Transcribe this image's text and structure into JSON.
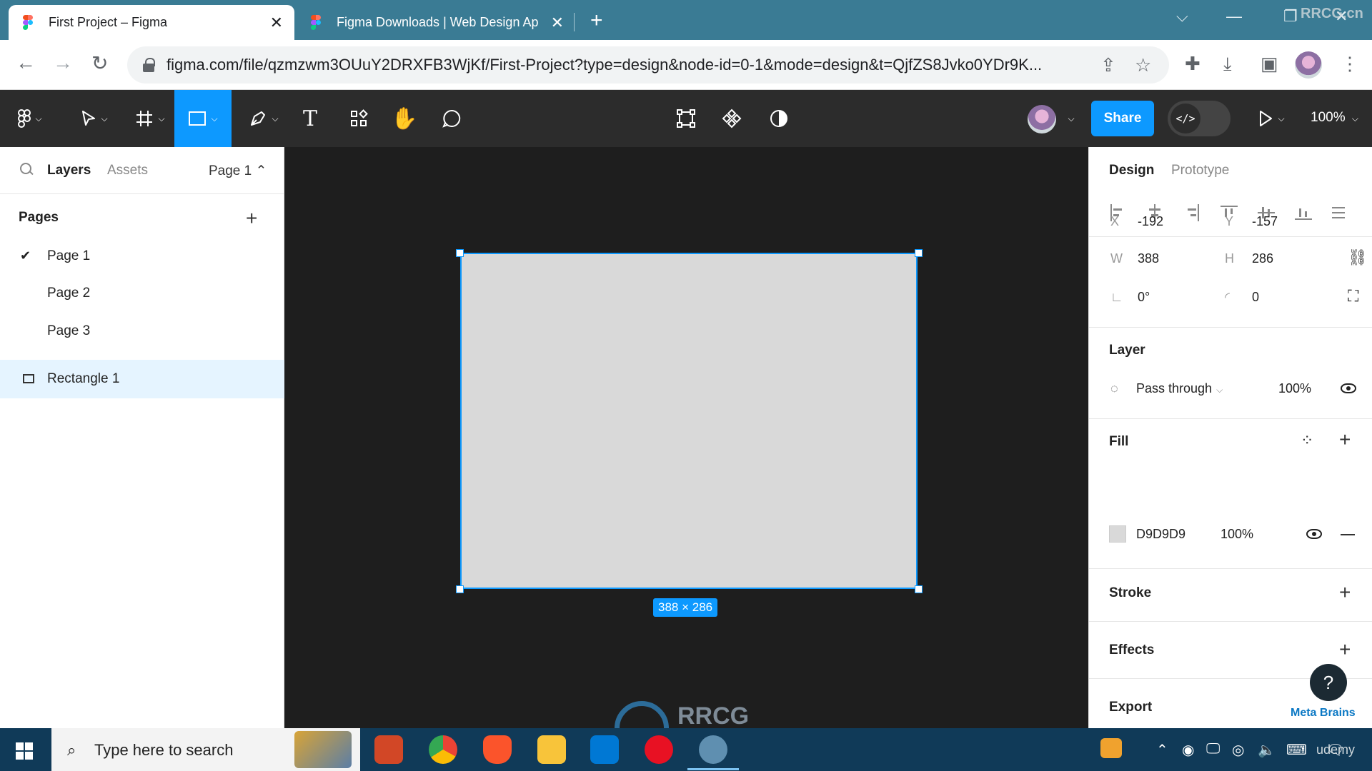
{
  "browser": {
    "tabs": [
      {
        "title": "First Project – Figma"
      },
      {
        "title": "Figma Downloads | Web Design Ap"
      }
    ],
    "url": "figma.com/file/qzmzwm3OUuY2DRXFB3WjKf/First-Project?type=design&node-id=0-1&mode=design&t=QjfZS8Jvko0YDr9K...",
    "watermark": "RRCG.cn"
  },
  "toolbar": {
    "share_label": "Share",
    "zoom": "100%",
    "dev_mode_glyph": "</>"
  },
  "left_panel": {
    "tabs": {
      "layers": "Layers",
      "assets": "Assets",
      "page_selector": "Page 1 ⌃"
    },
    "pages_header": "Pages",
    "pages": [
      "Page 1",
      "Page 2",
      "Page 3"
    ],
    "current_page": "Page 1",
    "layers": [
      {
        "name": "Rectangle 1"
      }
    ]
  },
  "canvas": {
    "dimension_badge": "388 × 286",
    "shape_fill": "#d9d9d9",
    "selection_color": "#0d99ff",
    "background": "#1e1e1e",
    "watermark": "RRCG"
  },
  "right_panel": {
    "tabs": {
      "design": "Design",
      "prototype": "Prototype"
    },
    "x": {
      "label": "X",
      "value": "-192"
    },
    "y": {
      "label": "Y",
      "value": "-157"
    },
    "w": {
      "label": "W",
      "value": "388"
    },
    "h": {
      "label": "H",
      "value": "286"
    },
    "rotation": "0°",
    "corner_radius": "0",
    "layer": {
      "header": "Layer",
      "blend": "Pass through",
      "opacity": "100%"
    },
    "fill": {
      "header": "Fill",
      "hex": "D9D9D9",
      "opacity": "100%"
    },
    "stroke_header": "Stroke",
    "effects_header": "Effects",
    "export_header": "Export",
    "brand": "Meta Brains"
  },
  "taskbar": {
    "search_placeholder": "Type here to search",
    "watermark": "udemy"
  }
}
